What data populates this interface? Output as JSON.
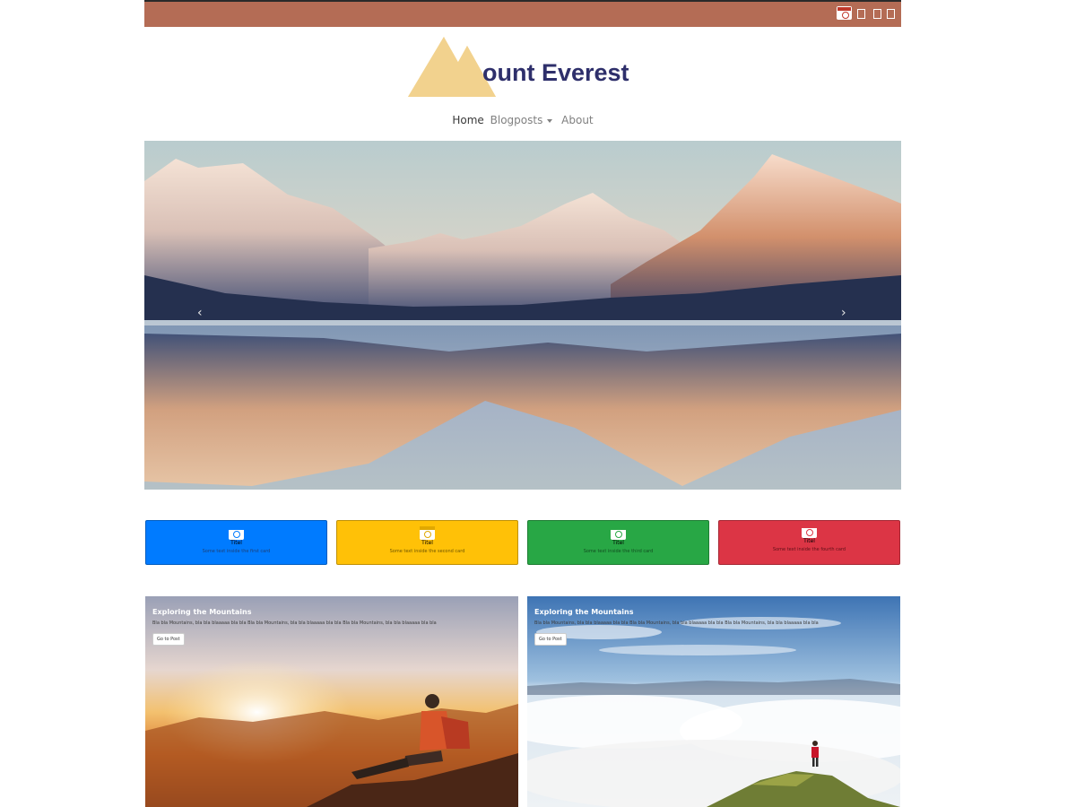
{
  "topbar": {
    "icons": [
      "app-icon",
      "square-icon",
      "square-icon",
      "square-icon"
    ],
    "color": "#b46c55"
  },
  "logo": {
    "text": "ount Everest",
    "mountain_color": "#f2d28e",
    "text_color": "#2e2f6b"
  },
  "nav": {
    "items": [
      {
        "label": "Home"
      },
      {
        "label": "Blogposts"
      },
      {
        "label": "About"
      }
    ]
  },
  "carousel": {
    "prev_label": "‹",
    "next_label": "›",
    "indicator_count": 3,
    "active_index": 0
  },
  "cards": [
    {
      "title": "Titel",
      "text": "Some text inside the first card",
      "color": "#007bff",
      "accent": "#007bff"
    },
    {
      "title": "Titel",
      "text": "Some text inside the second card",
      "color": "#ffc107",
      "accent": "#e0a800"
    },
    {
      "title": "Titel",
      "text": "Some text inside the third card",
      "color": "#28a745",
      "accent": "#28a745"
    },
    {
      "title": "Titel",
      "text": "Some text inside the fourth card",
      "color": "#dc3545",
      "accent": "#dc3545"
    }
  ],
  "posts": [
    {
      "title": "Exploring the Mountains",
      "text": "Bla bla Mountains, bla bla blaaaaa bla bla Bla bla Mountains, bla bla blaaaaa bla bla Bla bla Mountains, bla bla blaaaaa bla bla",
      "button": "Go to Post"
    },
    {
      "title": "Exploring the Mountains",
      "text": "Bla bla Mountains, bla bla blaaaaa bla bla Bla bla Mountains, bla bla blaaaaa bla bla Bla bla Mountains, bla bla blaaaaa bla bla",
      "button": "Go to Post"
    }
  ]
}
